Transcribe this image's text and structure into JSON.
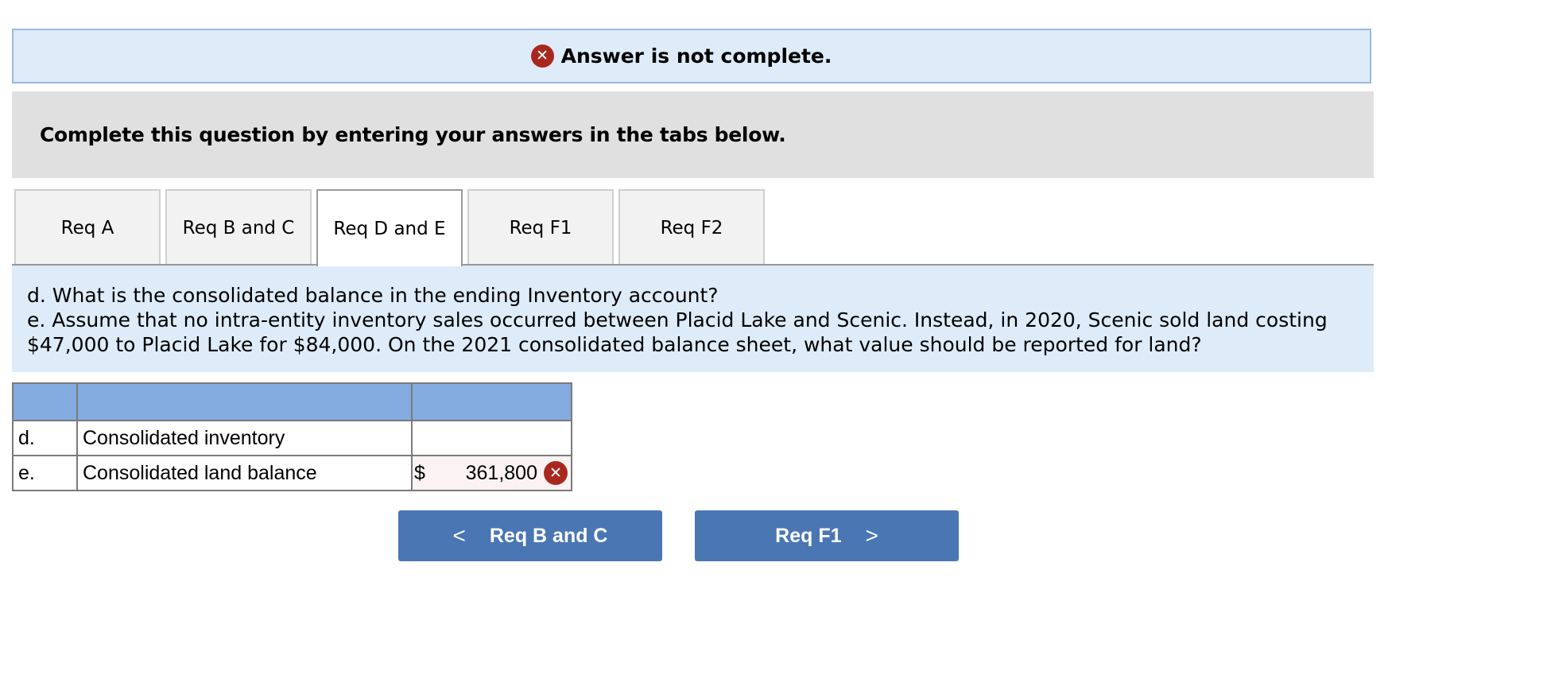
{
  "banner": {
    "icon": "error-x-icon",
    "text": "Answer is not complete."
  },
  "instructions": "Complete this question by entering your answers in the tabs below.",
  "tabs": [
    {
      "label": "Req A",
      "active": false
    },
    {
      "label": "Req B and C",
      "active": false
    },
    {
      "label": "Req D and E",
      "active": true
    },
    {
      "label": "Req F1",
      "active": false
    },
    {
      "label": "Req F2",
      "active": false
    }
  ],
  "question": {
    "line_d": "d. What is the consolidated balance in the ending Inventory account?",
    "line_e": "e. Assume that no intra-entity inventory sales occurred between Placid Lake and Scenic. Instead, in 2020, Scenic sold land costing $47,000 to Placid Lake for $84,000. On the 2021 consolidated balance sheet, what value should be reported for land?"
  },
  "table": {
    "rows": [
      {
        "letter": "d.",
        "label": "Consolidated inventory",
        "currency": "",
        "value": "",
        "status": ""
      },
      {
        "letter": "e.",
        "label": "Consolidated land balance",
        "currency": "$",
        "value": "361,800",
        "status": "incorrect"
      }
    ]
  },
  "nav": {
    "prev_label": "Req B and C",
    "next_label": "Req F1",
    "prev_icon": "chevron-left-icon",
    "next_icon": "chevron-right-icon"
  },
  "colors": {
    "error": "#a8281f",
    "button": "#4a76b4",
    "table_header": "#84abe0",
    "panel_blue": "#deebf8"
  }
}
